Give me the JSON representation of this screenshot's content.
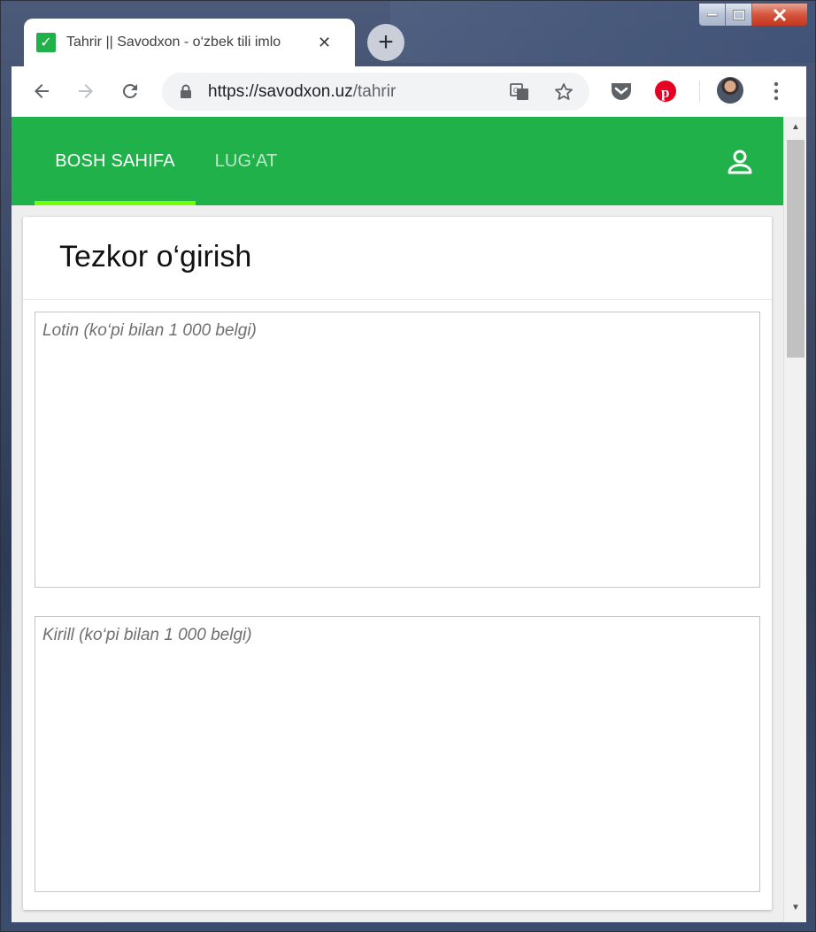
{
  "browser": {
    "tab": {
      "title": "Tahrir || Savodxon - o‘zbek tili imlo",
      "close_glyph": "✕",
      "favicon_glyph": "✓",
      "favicon_color": "#21b14b"
    },
    "new_tab_glyph": "+",
    "url": {
      "domain": "https://savodxon.uz",
      "path": "/tahrir"
    }
  },
  "app": {
    "brand_color": "#21b14b",
    "indicator_color": "#76ff03",
    "nav": {
      "home": "BOSH SAHIFA",
      "dictionary": "LUG‘AT"
    },
    "card_title": "Tezkor o‘girish",
    "latin_placeholder": "Lotin (ko‘pi bilan 1 000 belgi)",
    "cyrillic_placeholder": "Kirill (ko‘pi bilan 1 000 belgi)"
  }
}
